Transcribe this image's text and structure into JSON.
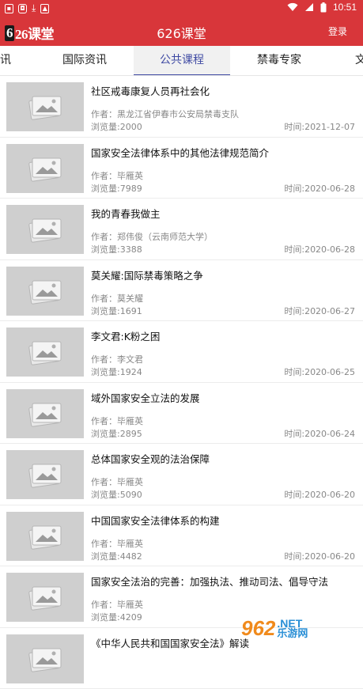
{
  "status_bar": {
    "time": "10:51",
    "left_icons": [
      "notification-icon",
      "app-icon",
      "download-icon",
      "image-icon"
    ],
    "right_icons": [
      "wifi-icon",
      "signal-icon",
      "battery-icon"
    ]
  },
  "app_bar": {
    "logo_text": "626课堂",
    "logo_number": "6",
    "logo_rest": "26课堂",
    "title": "626课堂",
    "login_label": "登录"
  },
  "tabs": [
    {
      "label": "讯"
    },
    {
      "label": "国际资讯"
    },
    {
      "label": "公共课程",
      "active": true
    },
    {
      "label": "禁毒专家"
    },
    {
      "label": "文"
    }
  ],
  "articles": [
    {
      "title": "社区戒毒康复人员再社会化",
      "author": "作者：黑龙江省伊春市公安局禁毒支队",
      "views": "浏览量:2000",
      "time": "时间:2021-12-07"
    },
    {
      "title": "国家安全法律体系中的其他法律规范简介",
      "author": "作者：毕雁英",
      "views": "浏览量:7989",
      "time": "时间:2020-06-28"
    },
    {
      "title": "我的青春我做主",
      "author": "作者：郑伟俊（云南师范大学）",
      "views": "浏览量:3388",
      "time": "时间:2020-06-28"
    },
    {
      "title": "莫关耀:国际禁毒策略之争",
      "author": "作者：莫关耀",
      "views": "浏览量:1691",
      "time": "时间:2020-06-27"
    },
    {
      "title": "李文君:K粉之困",
      "author": "作者：李文君",
      "views": "浏览量:1924",
      "time": "时间:2020-06-25"
    },
    {
      "title": "域外国家安全立法的发展",
      "author": "作者：毕雁英",
      "views": "浏览量:2895",
      "time": "时间:2020-06-24"
    },
    {
      "title": "总体国家安全观的法治保障",
      "author": "作者：毕雁英",
      "views": "浏览量:5090",
      "time": "时间:2020-06-20"
    },
    {
      "title": "中国国家安全法律体系的构建",
      "author": "作者：毕雁英",
      "views": "浏览量:4482",
      "time": "时间:2020-06-20"
    },
    {
      "title": "国家安全法治的完善：加强执法、推动司法、倡导守法",
      "author": "作者：毕雁英",
      "views": "浏览量:4209",
      "time": ""
    },
    {
      "title": "《中华人民共和国国家安全法》解读",
      "author": "",
      "views": "",
      "time": ""
    }
  ],
  "watermark": {
    "logo": "962",
    "net": ".NET",
    "cn": "乐游网"
  },
  "colors": {
    "brand": "#d8363a",
    "tab_active": "#3f4aa3",
    "thumb": "#cfcfcf"
  }
}
